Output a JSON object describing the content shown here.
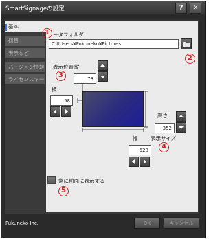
{
  "window": {
    "title": "SmartSignageの設定",
    "help_label": "?",
    "close_label": "✕"
  },
  "tabs": [
    {
      "label": "基本"
    },
    {
      "label": "切替"
    },
    {
      "label": "表示など"
    },
    {
      "label": "バージョン情報"
    },
    {
      "label": "ライセンスキー"
    }
  ],
  "basic": {
    "folder_label": "ータフォルダ",
    "folder_path": "C:¥Users¥Fukuneko¥Pictures",
    "display_position_label": "表示位置",
    "vertical_label": "縦",
    "vertical_value": "78",
    "horizontal_label": "横",
    "horizontal_value": "58",
    "height_label": "高さ",
    "height_value": "352",
    "display_size_label": "表示サイズ",
    "width_label": "幅",
    "width_value": "528",
    "always_on_top_label": "常に前面に表示する"
  },
  "annotations": {
    "one": "1",
    "two": "2",
    "three": "3",
    "four": "4",
    "five": "5",
    "color": "#d42020"
  },
  "footer": {
    "company": "Fukuneko Inc.",
    "ok_label": "OK",
    "cancel_label": "キャンセル"
  },
  "icons": {
    "folder": "folder-icon",
    "up": "arrow-up-icon",
    "down": "arrow-down-icon",
    "left": "arrow-left-icon",
    "right": "arrow-right-icon"
  },
  "colors": {
    "accent": "#3a6fd0",
    "panel": "#ebebeb",
    "dark": "#3a3a3a"
  }
}
